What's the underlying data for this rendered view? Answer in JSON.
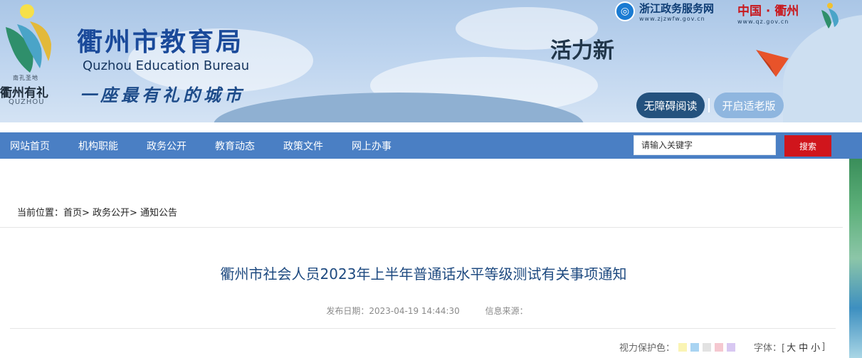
{
  "header": {
    "site_title": "衢州市教育局",
    "site_title_en": "Quzhou Education Bureau",
    "slogan": "一座最有礼的城市",
    "logo_small_text": "南孔圣地",
    "logo_city_text": "衢州有礼",
    "logo_en_text": "QUZHOU",
    "vitality_text": "活力新",
    "zhejiang_service_name": "浙江政务服务网",
    "zhejiang_service_url": "www.zjzwfw.gov.cn",
    "quzhou_portal_name": "中国 · 衢州",
    "quzhou_portal_url": "www.qz.gov.cn",
    "accessibility_button": "无障碍阅读",
    "elder_mode_button": "开启适老版"
  },
  "nav": {
    "items": [
      "网站首页",
      "机构职能",
      "政务公开",
      "教育动态",
      "政策文件",
      "网上办事"
    ]
  },
  "search": {
    "placeholder": "请输入关键字",
    "button": "搜索"
  },
  "breadcrumb": "当前位置：首页> 政务公开> 通知公告",
  "article": {
    "title": "衢州市社会人员2023年上半年普通话水平等级测试有关事项通知",
    "publish_date": "发布日期：2023-04-19 14:44:30",
    "source": "信息来源："
  },
  "tools": {
    "eye_protect_label": "视力保护色：",
    "swatch_colors": [
      "#faf4b4",
      "#a9d4f2",
      "#e2e2e2",
      "#f5c8d0",
      "#d8c8f2"
    ],
    "font_label": "字体：[",
    "font_sizes": [
      "大",
      "中",
      "小"
    ],
    "font_close": "]"
  },
  "colors": {
    "nav_bg": "#4a7fc4",
    "search_btn": "#d0151c",
    "title_color": "#1e4a80"
  }
}
